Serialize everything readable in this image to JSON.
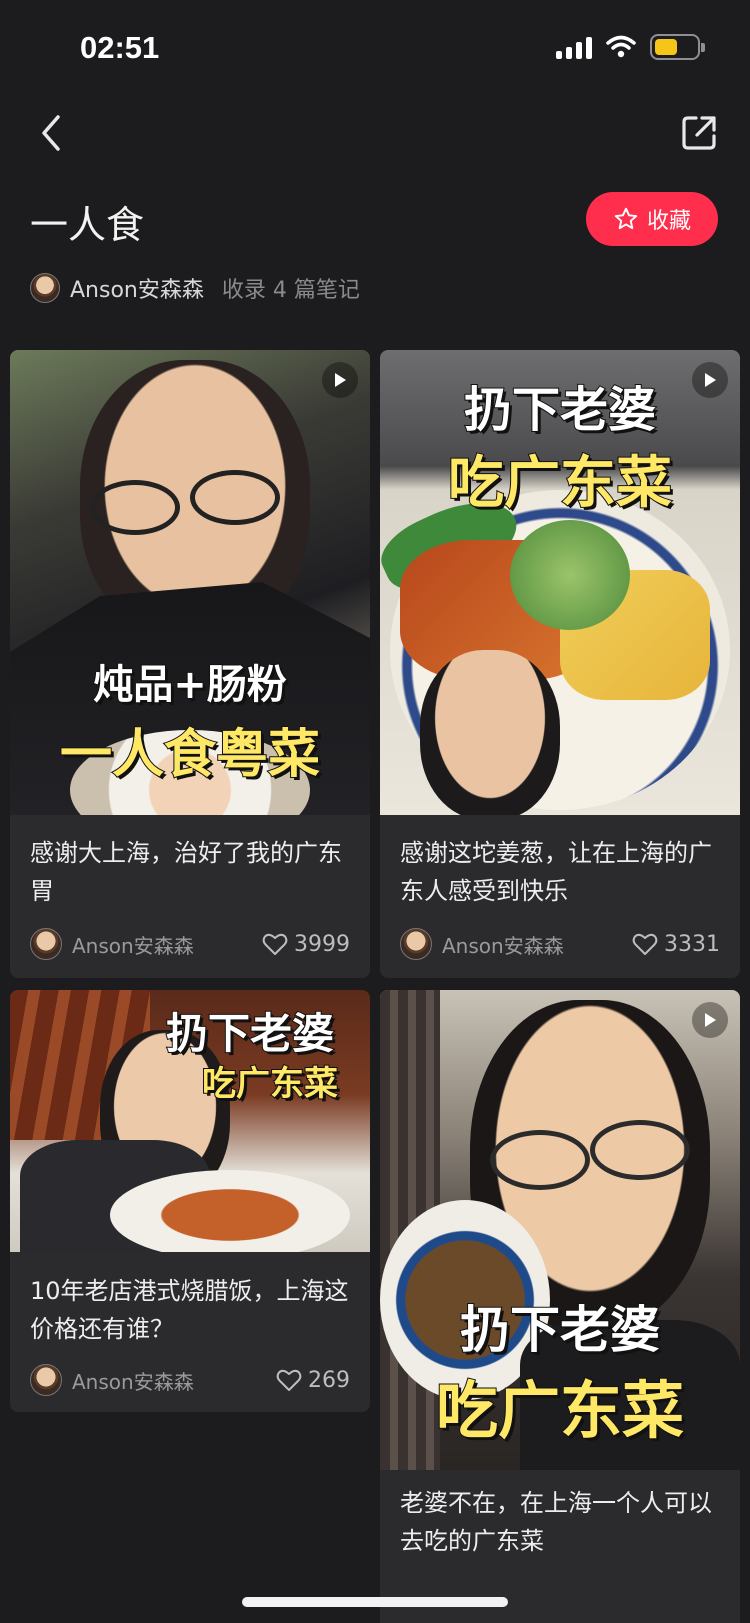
{
  "status_bar": {
    "time": "02:51"
  },
  "header": {
    "title": "一人食",
    "collect_label": "收藏",
    "author": "Anson安森森",
    "note_count": "收录 4 篇笔记"
  },
  "notes": [
    {
      "title": "感谢大上海，治好了我的广东胃",
      "author": "Anson安森森",
      "likes": "3999",
      "overlay": [
        "炖品+肠粉",
        "一人食粤菜"
      ]
    },
    {
      "title": "感谢这坨姜葱，让在上海的广东人感受到快乐",
      "author": "Anson安森森",
      "likes": "3331",
      "overlay": [
        "扔下老婆",
        "吃广东菜"
      ]
    },
    {
      "title": "10年老店港式烧腊饭，上海这价格还有谁？",
      "author": "Anson安森森",
      "likes": "269",
      "overlay": [
        "扔下老婆",
        "吃广东菜"
      ]
    },
    {
      "title": "老婆不在，在上海一个人可以去吃的广东菜",
      "author": "",
      "likes": "",
      "overlay": [
        "扔下老婆",
        "吃广东菜"
      ]
    }
  ],
  "colors": {
    "accent": "#ff2e4d",
    "background": "#1c1c1e",
    "card": "#2b2b2e"
  },
  "icons": [
    "back-icon",
    "share-icon",
    "star-icon",
    "play-icon",
    "heart-icon",
    "battery-icon",
    "wifi-icon",
    "signal-icon"
  ]
}
